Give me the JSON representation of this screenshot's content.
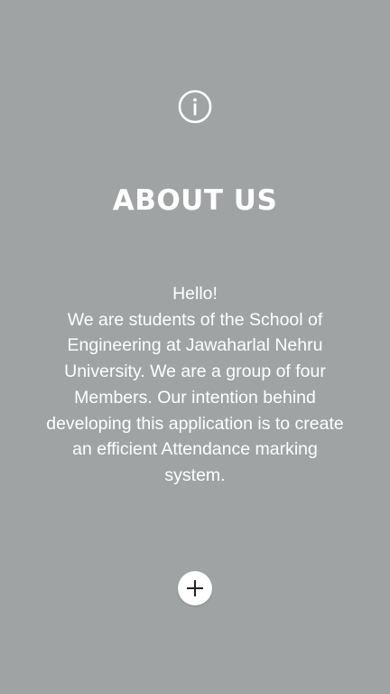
{
  "page": {
    "title": "ABOUT US",
    "greeting": "Hello!",
    "description": "We are students of the School of Engineering at Jawaharlal Nehru University. We are a group of four Members. Our intention behind developing this application is to create an efficient Attendance marking system."
  },
  "icons": {
    "header": "info-circle-icon",
    "fab": "plus-icon"
  },
  "colors": {
    "background": "#9fa3a3",
    "text": "#ffffff",
    "fab_background": "#ffffff",
    "fab_icon": "#222222"
  }
}
